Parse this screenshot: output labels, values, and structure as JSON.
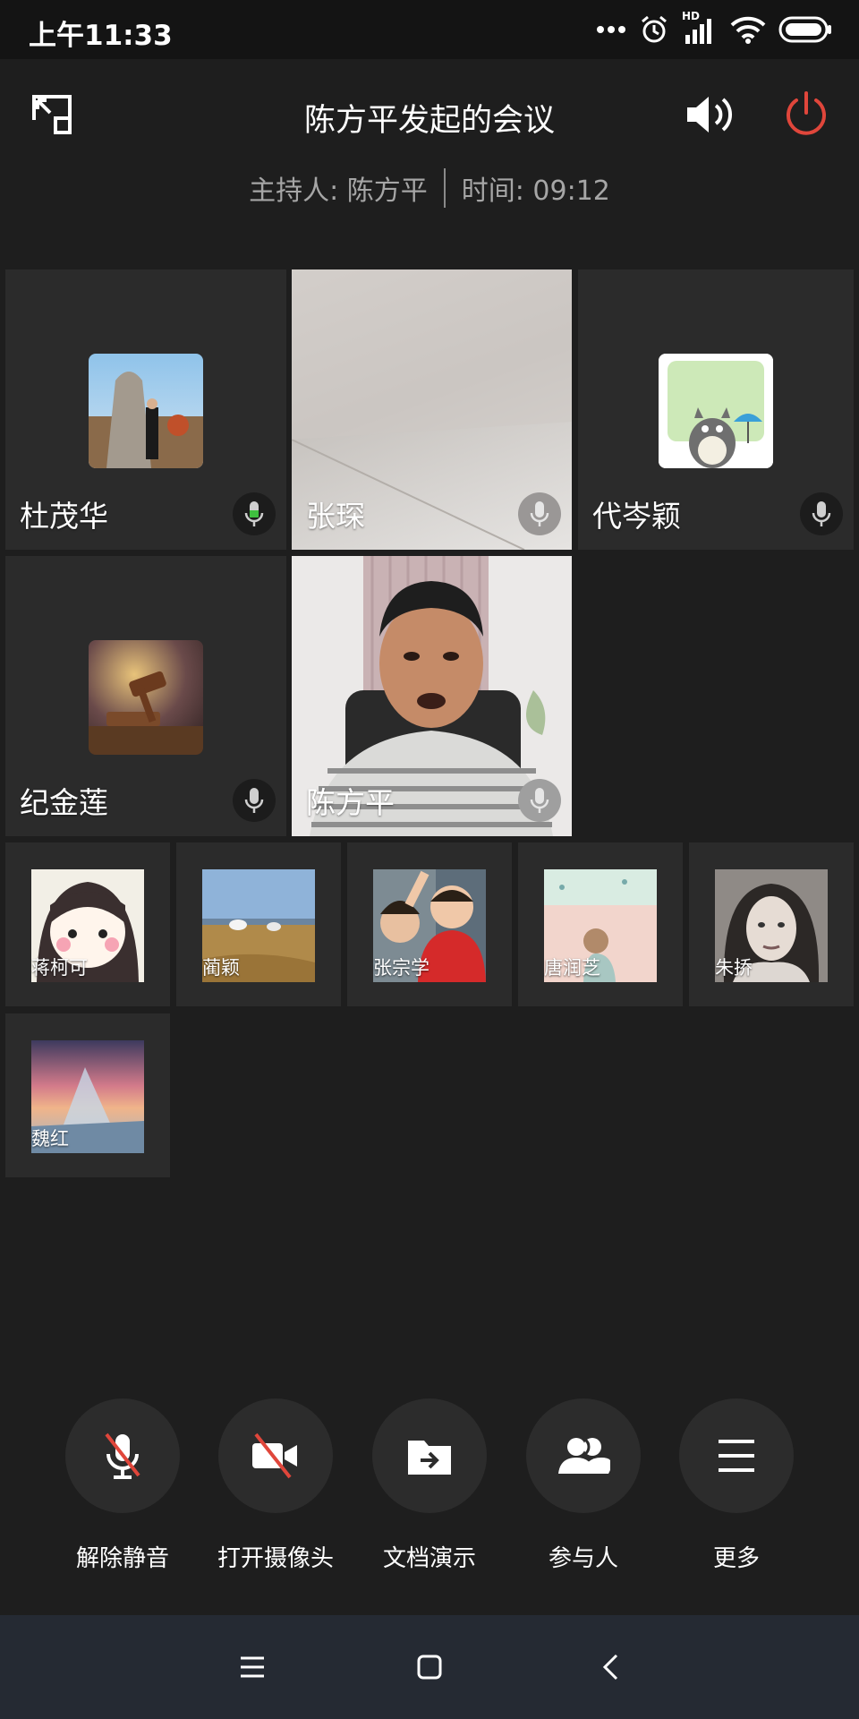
{
  "status_bar": {
    "time": "上午11:33",
    "network_label": "HD",
    "icons": [
      "more-dots-icon",
      "alarm-icon",
      "signal-icon",
      "wifi-icon",
      "battery-icon"
    ]
  },
  "header": {
    "title": "陈方平发起的会议",
    "host_label": "主持人: 陈方平",
    "time_label": "时间: 09:12"
  },
  "video_tiles": [
    {
      "name": "杜茂华",
      "mic": "active"
    },
    {
      "name": "张琛",
      "mic": "idle"
    },
    {
      "name": "代岑颖",
      "mic": "idle"
    },
    {
      "name": "纪金莲",
      "mic": "idle"
    },
    {
      "name": "陈方平",
      "mic": "idle"
    }
  ],
  "participants": [
    {
      "name": "蒋柯可"
    },
    {
      "name": "蔺颖"
    },
    {
      "name": "张宗学"
    },
    {
      "name": "唐润芝"
    },
    {
      "name": "朱挢"
    },
    {
      "name": "魏红"
    }
  ],
  "controls": [
    {
      "label": "解除静音",
      "icon": "mic-muted-icon"
    },
    {
      "label": "打开摄像头",
      "icon": "camera-off-icon"
    },
    {
      "label": "文档演示",
      "icon": "share-document-icon"
    },
    {
      "label": "参与人",
      "icon": "participants-icon"
    },
    {
      "label": "更多",
      "icon": "menu-icon"
    }
  ],
  "colors": {
    "power_red": "#e0463b",
    "mic_active_green": "#3fbf3f"
  }
}
